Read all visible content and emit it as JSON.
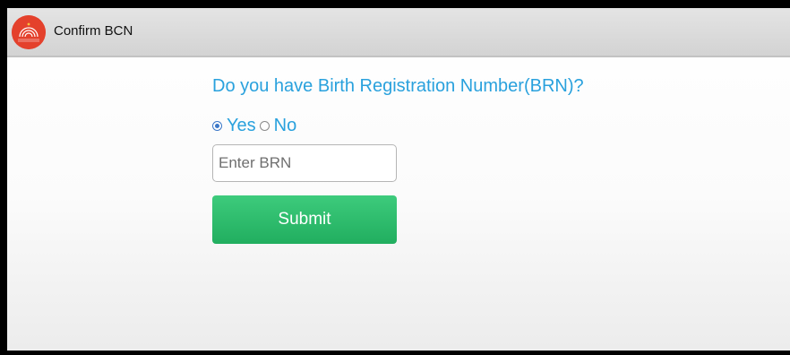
{
  "app": {
    "title": "Confirm BCN",
    "icon": "aadhaar-logo-icon",
    "icon_text": "AADHAAR"
  },
  "form": {
    "question": "Do you have Birth Registration Number(BRN)?",
    "options": [
      {
        "label": "Yes",
        "checked": true
      },
      {
        "label": "No",
        "checked": false
      }
    ],
    "brn_placeholder": "Enter BRN",
    "brn_value": "",
    "submit_label": "Submit"
  },
  "colors": {
    "accent_text": "#29a1dd",
    "submit_button": "#2dba6b",
    "logo_red": "#e4412c"
  }
}
